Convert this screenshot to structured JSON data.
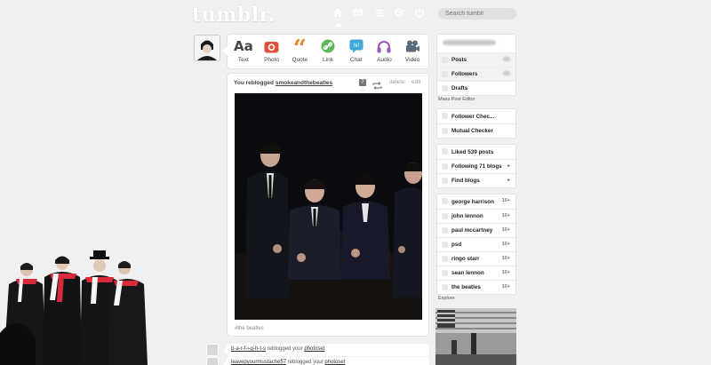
{
  "header": {
    "logo": "tumblr.",
    "search_placeholder": "Search tumblr"
  },
  "post_types": [
    {
      "label": "Text",
      "icon": "text-icon",
      "color": "#444444"
    },
    {
      "label": "Photo",
      "icon": "camera-icon",
      "color": "#e0513b"
    },
    {
      "label": "Quote",
      "icon": "quote-icon",
      "color": "#e08a2a"
    },
    {
      "label": "Link",
      "icon": "link-icon",
      "color": "#5cb85c"
    },
    {
      "label": "Chat",
      "icon": "chat-icon",
      "color": "#3fa8d8",
      "badge": "hi!"
    },
    {
      "label": "Audio",
      "icon": "headphones-icon",
      "color": "#9b59b6"
    },
    {
      "label": "Video",
      "icon": "video-camera-icon",
      "color": "#5a6b7c"
    }
  ],
  "post": {
    "prefix": "You reblogged",
    "source": "smokeandthebeatles",
    "note_count": "7",
    "delete_label": "delete",
    "edit_label": "edit",
    "tags": "#the beatles"
  },
  "notifications": [
    {
      "user": "b-a-r-f-i-g-h-t-s",
      "action": "reblogged your",
      "item": "photoset"
    },
    {
      "user": "leavepyourmustache57",
      "action": "reblogged your",
      "item": "photoset"
    }
  ],
  "sidebar": {
    "blog_items": [
      {
        "label": "Posts",
        "count": ""
      },
      {
        "label": "Followers",
        "count": ""
      },
      {
        "label": "Drafts",
        "count": ""
      }
    ],
    "mass_post_editor": "Mass Post Editor",
    "tools": [
      {
        "label": "Follower Chec..."
      },
      {
        "label": "Mutual Checker"
      }
    ],
    "activity": [
      {
        "label": "Liked 539 posts",
        "count": ""
      },
      {
        "label": "Following 71 blogs",
        "count": "▸"
      },
      {
        "label": "Find blogs",
        "count": "▸"
      }
    ],
    "tags": [
      {
        "label": "george harrison",
        "count": "10+"
      },
      {
        "label": "john lennon",
        "count": "10+"
      },
      {
        "label": "paul mccartney",
        "count": "10+"
      },
      {
        "label": "psd",
        "count": "10+"
      },
      {
        "label": "ringo starr",
        "count": "10+"
      },
      {
        "label": "sean lennon",
        "count": "10+"
      },
      {
        "label": "the beatles",
        "count": "10+"
      }
    ],
    "explore": "Explore"
  }
}
